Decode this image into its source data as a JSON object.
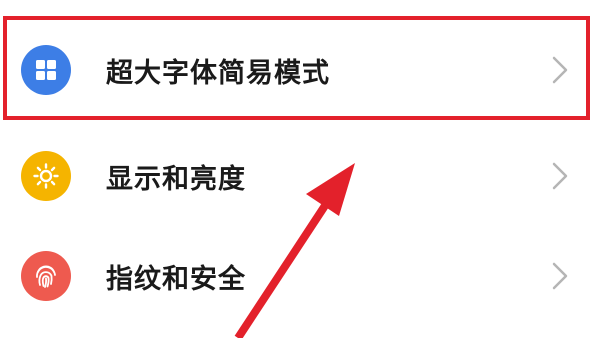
{
  "settings": {
    "items": [
      {
        "label": "超大字体简易模式",
        "icon": "grid-icon",
        "icon_color": "#3d7ee6"
      },
      {
        "label": "显示和亮度",
        "icon": "sun-icon",
        "icon_color": "#f5b400"
      },
      {
        "label": "指纹和安全",
        "icon": "fingerprint-icon",
        "icon_color": "#ee5a4f"
      }
    ]
  },
  "annotation": {
    "highlight_color": "#e3212b",
    "arrow_color": "#e3212b"
  }
}
